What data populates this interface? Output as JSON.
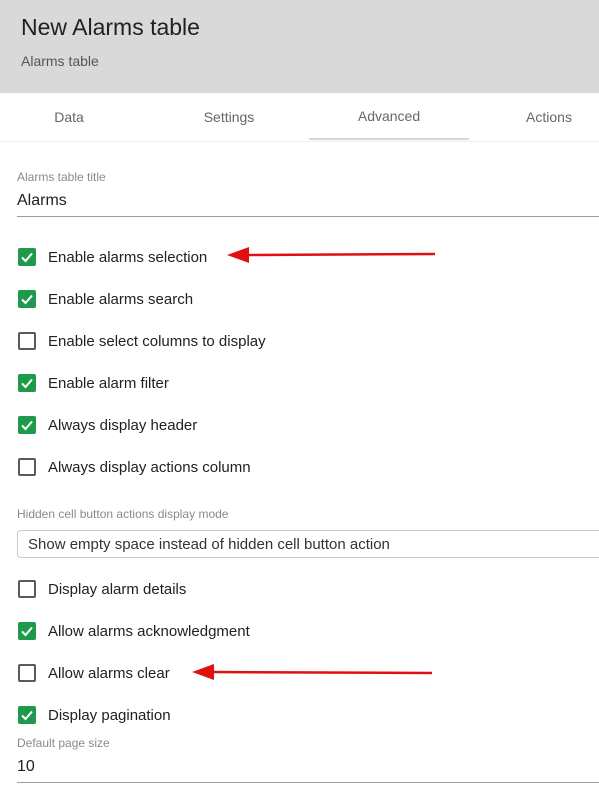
{
  "header": {
    "title": "New Alarms table",
    "subtitle": "Alarms table"
  },
  "tabs": [
    {
      "label": "Data"
    },
    {
      "label": "Settings"
    },
    {
      "label": "Advanced",
      "selected": true
    },
    {
      "label": "Actions"
    }
  ],
  "form": {
    "title_field": {
      "label": "Alarms table title",
      "value": "Alarms"
    },
    "checkboxes_top": [
      {
        "label": "Enable alarms selection",
        "checked": true
      },
      {
        "label": "Enable alarms search",
        "checked": true
      },
      {
        "label": "Enable select columns to display",
        "checked": false
      },
      {
        "label": "Enable alarm filter",
        "checked": true
      },
      {
        "label": "Always display header",
        "checked": true
      },
      {
        "label": "Always display actions column",
        "checked": false
      }
    ],
    "display_mode": {
      "label": "Hidden cell button actions display mode",
      "value": "Show empty space instead of hidden cell button action"
    },
    "checkboxes_bottom": [
      {
        "label": "Display alarm details",
        "checked": false
      },
      {
        "label": "Allow alarms acknowledgment",
        "checked": true
      },
      {
        "label": "Allow alarms clear",
        "checked": false
      },
      {
        "label": "Display pagination",
        "checked": true
      }
    ],
    "page_size": {
      "label": "Default page size",
      "value": "10"
    }
  },
  "colors": {
    "checkbox_checked": "#1f9a4b",
    "annotation_arrow": "#e01010",
    "header_bg": "#d9d9d9"
  },
  "icons": {
    "checkmark": "check-icon",
    "annotation": "arrow-left-icon"
  }
}
